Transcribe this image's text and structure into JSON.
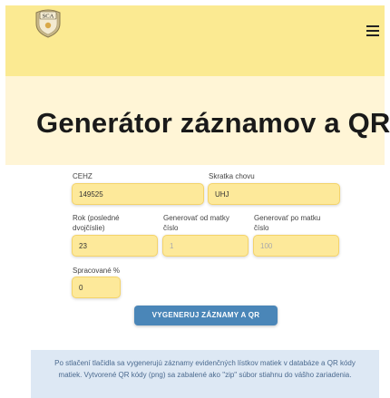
{
  "header": {
    "logo_text": "SCA",
    "menu_icon": "hamburger-menu-icon"
  },
  "hero": {
    "title": "Generátor záznamov a QR"
  },
  "form": {
    "cehz": {
      "label": "CEHZ",
      "value": "149525"
    },
    "skratka": {
      "label": "Skratka chovu",
      "value": "UHJ"
    },
    "rok": {
      "label": "Rok (posledné dvojčíslie)",
      "value": "23"
    },
    "od_matky": {
      "label": "Generovať od matky číslo",
      "placeholder": "1"
    },
    "po_matku": {
      "label": "Generovať po matku číslo",
      "placeholder": "100"
    },
    "spracovane": {
      "label": "Spracované %",
      "value": "0"
    },
    "submit_label": "VYGENERUJ ZÁZNAMY A QR"
  },
  "info": {
    "text": "Po stlačení tlačidla sa vygenerujú záznamy evidenčných lístkov matiek v databáze a QR kódy matiek. Vytvorené QR kódy (png) sa zabalené ako \"zip\" súbor stiahnu do vášho zariadenia."
  },
  "colors": {
    "header_bg": "#fbea92",
    "hero_bg": "#fff5d6",
    "field_bg": "#fde99a",
    "button_bg": "#4a86b8",
    "info_bg": "#dde8f4"
  }
}
